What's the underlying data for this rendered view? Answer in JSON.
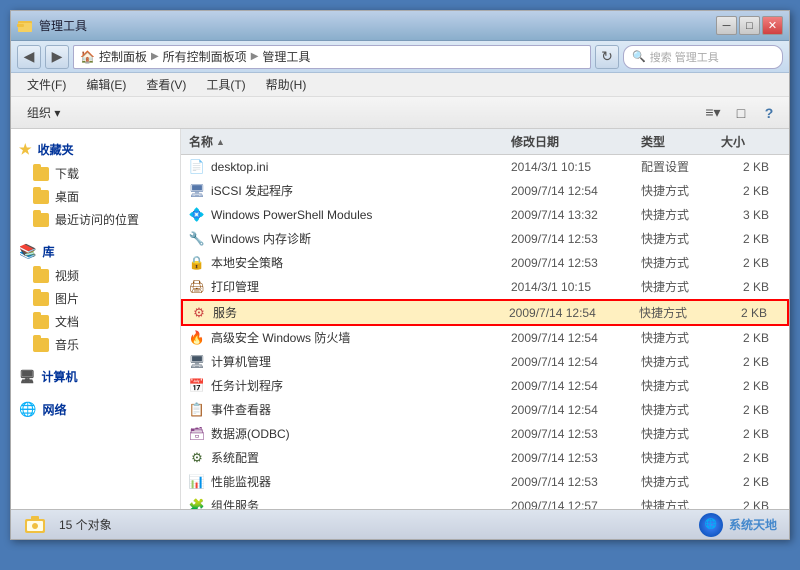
{
  "window": {
    "title": "管理工具",
    "min_btn": "─",
    "max_btn": "□",
    "close_btn": "✕"
  },
  "nav": {
    "back_tooltip": "后退",
    "forward_tooltip": "前进",
    "address_parts": [
      "控制面板",
      "所有控制面板项",
      "管理工具"
    ],
    "refresh_tooltip": "刷新",
    "search_placeholder": "搜索 管理工具"
  },
  "menu": {
    "items": [
      "文件(F)",
      "编辑(E)",
      "查看(V)",
      "工具(T)",
      "帮助(H)"
    ]
  },
  "toolbar": {
    "organize": "组织 ▾",
    "view_change": "≡",
    "view_detail": "□",
    "help_btn": "?"
  },
  "sidebar": {
    "favorites_label": "收藏夹",
    "download_label": "下载",
    "desktop_label": "桌面",
    "recent_label": "最近访问的位置",
    "library_label": "库",
    "video_label": "视频",
    "picture_label": "图片",
    "doc_label": "文档",
    "music_label": "音乐",
    "computer_label": "计算机",
    "network_label": "网络"
  },
  "filelist": {
    "col_name": "名称",
    "col_date": "修改日期",
    "col_type": "类型",
    "col_size": "大小",
    "files": [
      {
        "icon": "📄",
        "icon_class": "ini-icon",
        "name": "desktop.ini",
        "date": "2014/3/1 10:15",
        "type": "配置设置",
        "size": "2 KB"
      },
      {
        "icon": "🖥",
        "icon_class": "shortcut-icon",
        "name": "iSCSI 发起程序",
        "date": "2009/7/14 12:54",
        "type": "快捷方式",
        "size": "2 KB"
      },
      {
        "icon": "💠",
        "icon_class": "powershell-icon",
        "name": "Windows PowerShell Modules",
        "date": "2009/7/14 13:32",
        "type": "快捷方式",
        "size": "3 KB"
      },
      {
        "icon": "🔧",
        "icon_class": "mmc-icon",
        "name": "Windows 内存诊断",
        "date": "2009/7/14 12:53",
        "type": "快捷方式",
        "size": "2 KB"
      },
      {
        "icon": "🔒",
        "icon_class": "security-icon",
        "name": "本地安全策略",
        "date": "2009/7/14 12:53",
        "type": "快捷方式",
        "size": "2 KB"
      },
      {
        "icon": "🖨",
        "icon_class": "print-icon",
        "name": "打印管理",
        "date": "2014/3/1 10:15",
        "type": "快捷方式",
        "size": "2 KB"
      },
      {
        "icon": "⚙",
        "icon_class": "service-icon",
        "name": "服务",
        "date": "2009/7/14 12:54",
        "type": "快捷方式",
        "size": "2 KB",
        "highlighted": true
      },
      {
        "icon": "🔥",
        "icon_class": "shortcut-icon",
        "name": "高级安全 Windows 防火墙",
        "date": "2009/7/14 12:54",
        "type": "快捷方式",
        "size": "2 KB"
      },
      {
        "icon": "🖥",
        "icon_class": "comp-icon",
        "name": "计算机管理",
        "date": "2009/7/14 12:54",
        "type": "快捷方式",
        "size": "2 KB"
      },
      {
        "icon": "📅",
        "icon_class": "task-icon",
        "name": "任务计划程序",
        "date": "2009/7/14 12:54",
        "type": "快捷方式",
        "size": "2 KB"
      },
      {
        "icon": "📋",
        "icon_class": "event-icon",
        "name": "事件查看器",
        "date": "2009/7/14 12:54",
        "type": "快捷方式",
        "size": "2 KB"
      },
      {
        "icon": "🗃",
        "icon_class": "odbc-icon",
        "name": "数据源(ODBC)",
        "date": "2009/7/14 12:53",
        "type": "快捷方式",
        "size": "2 KB"
      },
      {
        "icon": "⚙",
        "icon_class": "config-icon",
        "name": "系统配置",
        "date": "2009/7/14 12:53",
        "type": "快捷方式",
        "size": "2 KB"
      },
      {
        "icon": "📊",
        "icon_class": "perf-icon",
        "name": "性能监视器",
        "date": "2009/7/14 12:53",
        "type": "快捷方式",
        "size": "2 KB"
      },
      {
        "icon": "🧩",
        "icon_class": "mmc-icon",
        "name": "组件服务",
        "date": "2009/7/14 12:57",
        "type": "快捷方式",
        "size": "2 KB"
      }
    ]
  },
  "statusbar": {
    "count_text": "15 个对象",
    "watermark": "系统天地"
  }
}
